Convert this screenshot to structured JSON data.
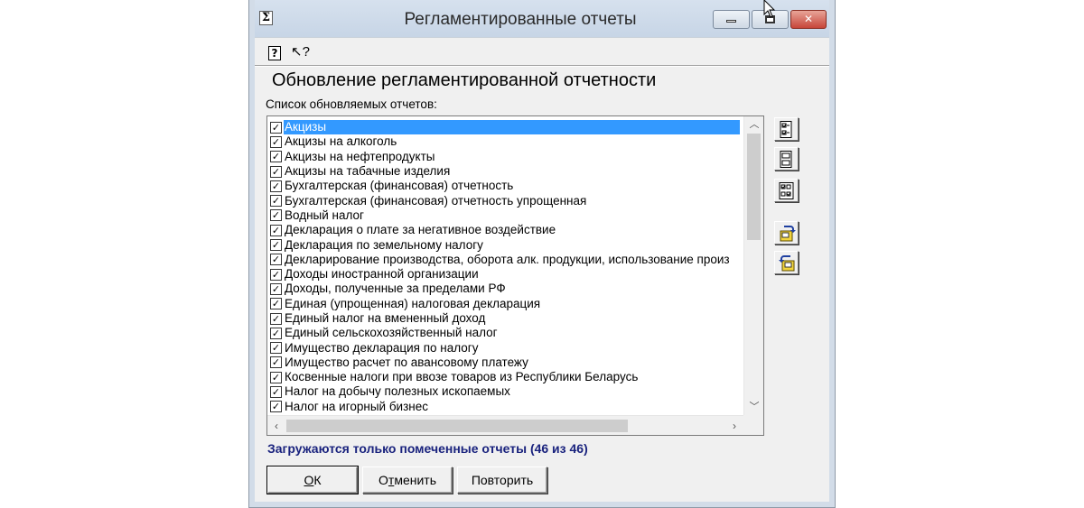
{
  "window": {
    "title": "Регламентированные отчеты",
    "sys_icon": "Σ"
  },
  "toolbar": {
    "help_glyph": "?",
    "whatsthis_glyph": "↖?"
  },
  "page": {
    "title": "Обновление регламентированной отчетности",
    "list_label": "Список обновляемых отчетов:"
  },
  "reports": [
    {
      "label": "Акцизы",
      "checked": true,
      "selected": true
    },
    {
      "label": "Акцизы на алкоголь",
      "checked": true
    },
    {
      "label": "Акцизы на нефтепродукты",
      "checked": true
    },
    {
      "label": "Акцизы на табачные изделия",
      "checked": true
    },
    {
      "label": "Бухгалтерская (финансовая) отчетность",
      "checked": true
    },
    {
      "label": "Бухгалтерская (финансовая) отчетность упрощенная",
      "checked": true
    },
    {
      "label": "Водный налог",
      "checked": true
    },
    {
      "label": "Декларация о плате за негативное воздействие",
      "checked": true
    },
    {
      "label": "Декларация по земельному налогу",
      "checked": true
    },
    {
      "label": "Декларирование производства, оборота алк. продукции, использование произ",
      "checked": true
    },
    {
      "label": "Доходы иностранной организации",
      "checked": true
    },
    {
      "label": "Доходы, полученные за пределами РФ",
      "checked": true
    },
    {
      "label": "Единая (упрощенная) налоговая декларация",
      "checked": true
    },
    {
      "label": "Единый налог на вмененный доход",
      "checked": true
    },
    {
      "label": "Единый сельскохозяйственный налог",
      "checked": true
    },
    {
      "label": "Имущество декларация по налогу",
      "checked": true
    },
    {
      "label": "Имущество расчет по авансовому платежу",
      "checked": true
    },
    {
      "label": "Косвенные налоги при ввозе товаров из Республики Беларусь",
      "checked": true
    },
    {
      "label": "Налог на добычу полезных ископаемых",
      "checked": true
    },
    {
      "label": "Налог на игорный бизнес",
      "checked": true
    }
  ],
  "status": {
    "text": "Загружаются только помеченные отчеты",
    "count": "(46 из 46)"
  },
  "buttons": {
    "ok_mnemonic": "О",
    "ok_rest": "К",
    "cancel_pre": "О",
    "cancel_mnemonic": "т",
    "cancel_rest": "менить",
    "retry_label": "Повторить"
  },
  "colors": {
    "selection": "#3399ff",
    "status_text": "#1a237e"
  }
}
